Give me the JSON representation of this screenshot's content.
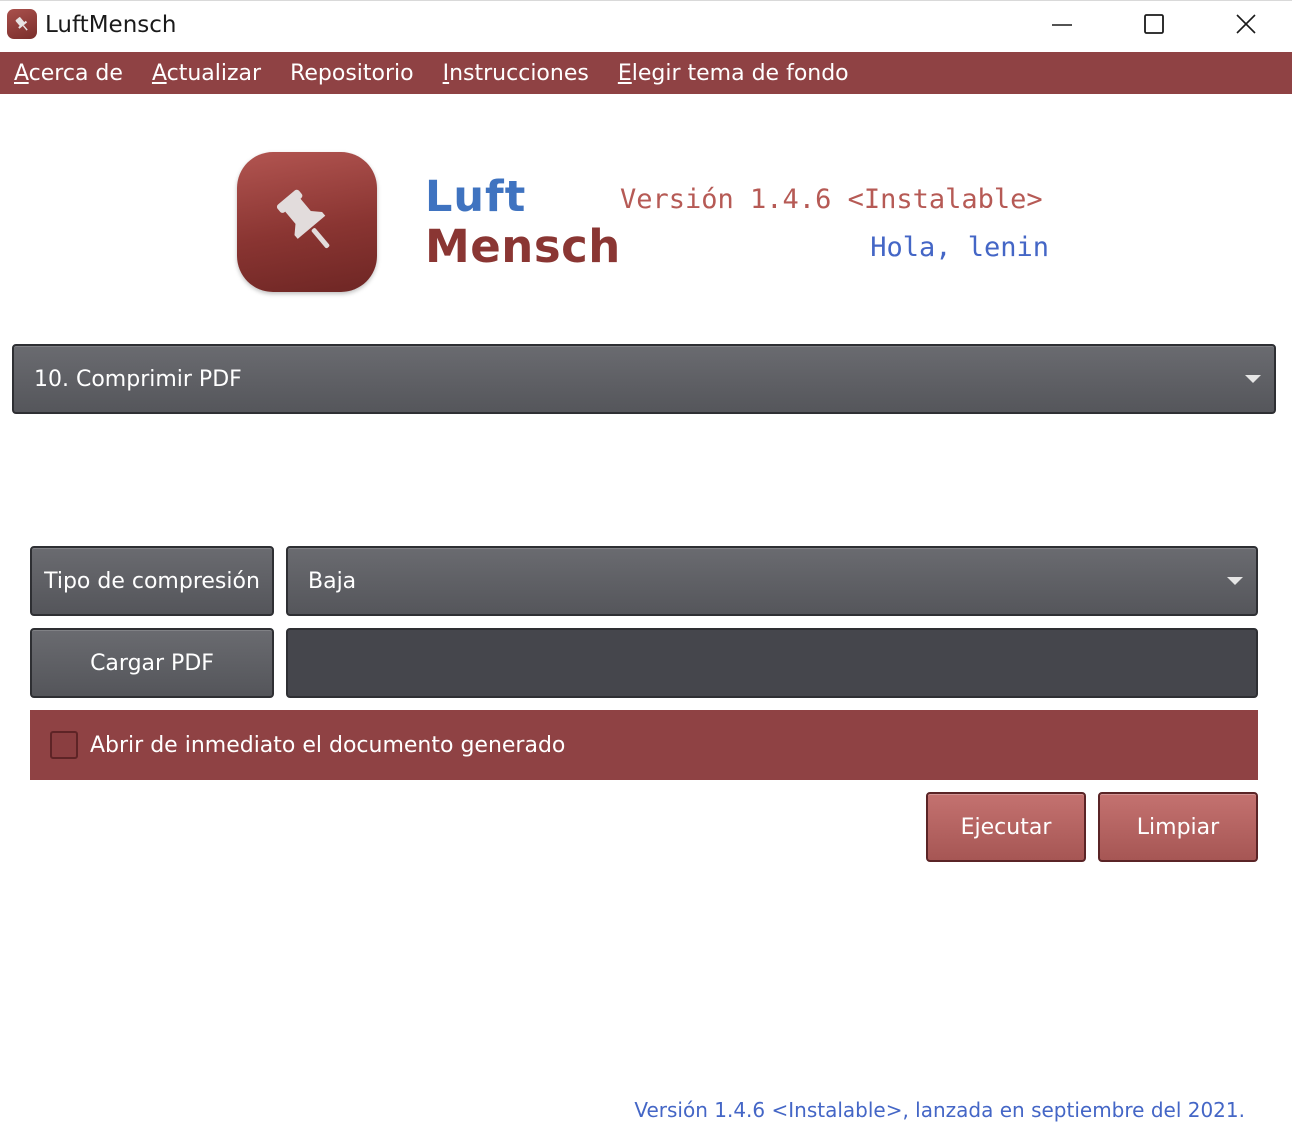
{
  "window": {
    "title": "LuftMensch",
    "icon": "pushpin-app-icon"
  },
  "menu": {
    "items": [
      {
        "mnemonic": "A",
        "rest": "cerca de"
      },
      {
        "mnemonic": "A",
        "rest": "ctualizar"
      },
      {
        "mnemonic": "",
        "rest": "Repositorio"
      },
      {
        "mnemonic": "I",
        "rest": "nstrucciones"
      },
      {
        "mnemonic": "E",
        "rest": "legir tema de fondo"
      }
    ]
  },
  "header": {
    "logo_line1": "Luft",
    "logo_line2": "Mensch",
    "version": "Versión 1.4.6 <Instalable>",
    "greeting": "Hola, lenin"
  },
  "function_select": {
    "selected": "10. Comprimir PDF"
  },
  "compression": {
    "label": "Tipo de compresión",
    "selected": "Baja"
  },
  "load": {
    "button_label": "Cargar PDF",
    "path_value": ""
  },
  "open_after": {
    "label": "Abrir de inmediato el documento generado",
    "checked": false
  },
  "actions": {
    "run_label": "Ejecutar",
    "clear_label": "Limpiar"
  },
  "footer": {
    "text": "Versión 1.4.6 <Instalable>, lanzada en septiembre del 2021."
  },
  "colors": {
    "accent": "#8f4244",
    "logo_blue": "#3f73c0",
    "version_red": "#b65a55",
    "greeting_blue": "#4466c6"
  }
}
